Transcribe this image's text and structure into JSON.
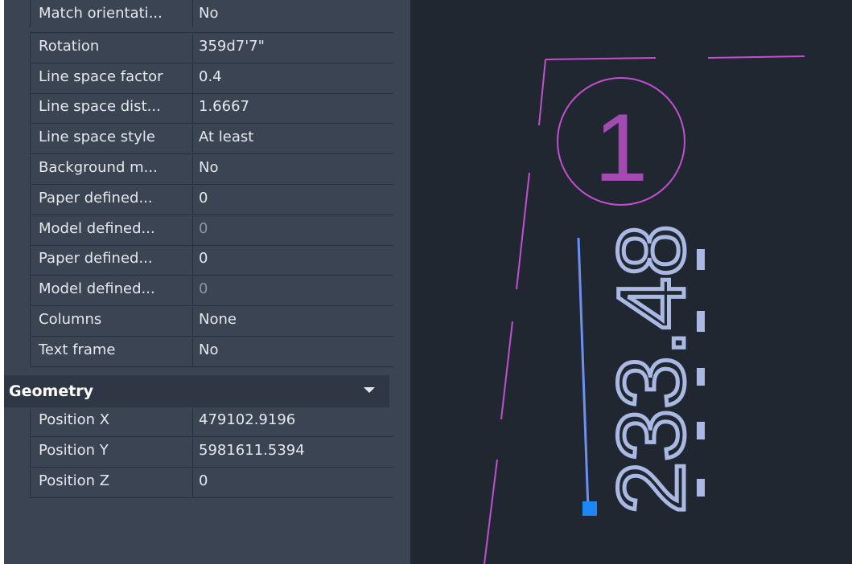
{
  "properties": {
    "text_rows": [
      {
        "label": "Match orientati...",
        "value": "No",
        "dim": false
      },
      {
        "label": "Rotation",
        "value": "359d7'7\"",
        "dim": false
      },
      {
        "label": "Line space factor",
        "value": "0.4",
        "dim": false
      },
      {
        "label": "Line space dist...",
        "value": "1.6667",
        "dim": false
      },
      {
        "label": "Line space style",
        "value": "At least",
        "dim": false
      },
      {
        "label": "Background m...",
        "value": "No",
        "dim": false
      },
      {
        "label": "Paper defined...",
        "value": "0",
        "dim": false
      },
      {
        "label": "Model defined...",
        "value": "0",
        "dim": true
      },
      {
        "label": "Paper defined...",
        "value": "0",
        "dim": false
      },
      {
        "label": "Model defined...",
        "value": "0",
        "dim": true
      },
      {
        "label": "Columns",
        "value": "None",
        "dim": false
      },
      {
        "label": "Text frame",
        "value": "No",
        "dim": false
      }
    ],
    "geometry": {
      "title": "Geometry",
      "rows": [
        {
          "label": "Position X",
          "value": "479102.9196"
        },
        {
          "label": "Position Y",
          "value": "5981611.5394"
        },
        {
          "label": "Position Z",
          "value": "0"
        }
      ]
    }
  },
  "drawing": {
    "circle_label": "1",
    "dimension_text": "233.48",
    "colors": {
      "magenta": "#c24fd0",
      "text": "#a9b9e3",
      "selection_line": "#6d8ff0",
      "grip": "#1f86f5"
    }
  }
}
